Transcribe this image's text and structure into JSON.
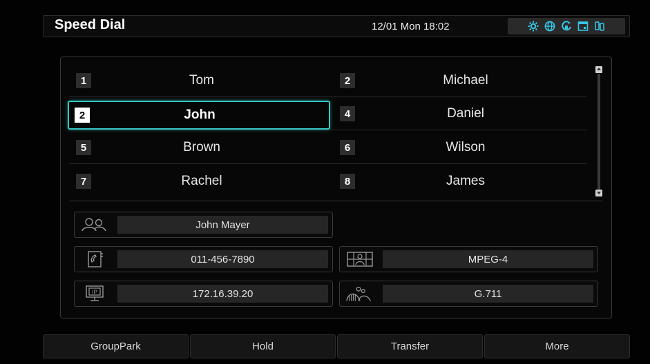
{
  "header": {
    "title": "Speed Dial",
    "datetime": "12/01 Mon 18:02",
    "status_icons": [
      "settings-icon",
      "network-globe-icon",
      "call-forward-icon",
      "calendar-icon",
      "mobile-sync-icon"
    ]
  },
  "speed_dial": {
    "rows": [
      {
        "left": {
          "num": "1",
          "name": "Tom"
        },
        "right": {
          "num": "2",
          "name": "Michael"
        }
      },
      {
        "left": {
          "num": "2",
          "name": "John"
        },
        "right": {
          "num": "4",
          "name": "Daniel"
        }
      },
      {
        "left": {
          "num": "5",
          "name": "Brown"
        },
        "right": {
          "num": "6",
          "name": "Wilson"
        }
      },
      {
        "left": {
          "num": "7",
          "name": "Rachel"
        },
        "right": {
          "num": "8",
          "name": "James"
        }
      }
    ],
    "selected": "John"
  },
  "details": {
    "contact_name": "John Mayer",
    "phone_number": "011-456-7890",
    "ip_address": "172.16.39.20",
    "video_codec": "MPEG-4",
    "audio_codec": "G.711"
  },
  "softkeys": [
    "GroupPark",
    "Hold",
    "Transfer",
    "More"
  ],
  "colors": {
    "accent": "#34c9c4",
    "status_icon": "#35c6e6"
  }
}
